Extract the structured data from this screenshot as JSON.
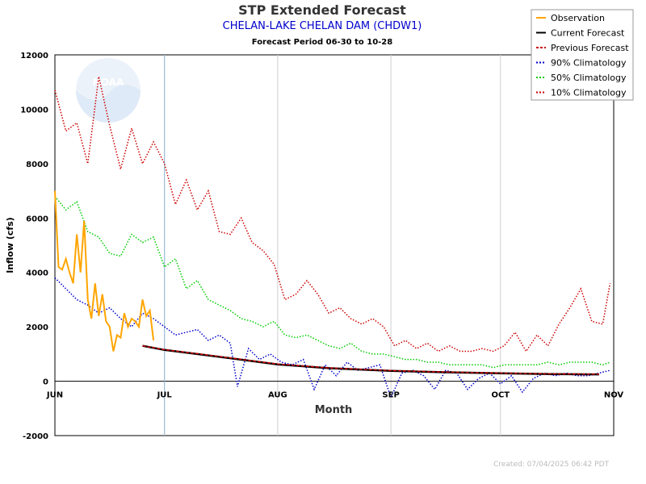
{
  "chart_data": {
    "type": "line",
    "title": "STP Extended Forecast",
    "subtitle": "CHELAN-LAKE CHELAN DAM (CHDW1)",
    "forecast_period": "Forecast Period  06-30 to  10-28",
    "xlabel": "Month",
    "ylabel": "Inflow (cfs)",
    "created": "Created:  07/04/2025 06:42 PDT",
    "logo_text": "NOAA",
    "xlim": [
      "2025-06-01",
      "2025-11-01"
    ],
    "ylim": [
      -2000,
      12000
    ],
    "yticks": [
      -2000,
      0,
      2000,
      4000,
      6000,
      8000,
      10000,
      12000
    ],
    "xticks": [
      {
        "date": "2025-06-01",
        "label": "JUN"
      },
      {
        "date": "2025-07-01",
        "label": "JUL"
      },
      {
        "date": "2025-08-01",
        "label": "AUG"
      },
      {
        "date": "2025-09-01",
        "label": "SEP"
      },
      {
        "date": "2025-10-01",
        "label": "OCT"
      },
      {
        "date": "2025-11-01",
        "label": "NOV"
      }
    ],
    "current_date_marker": "2025-07-01",
    "grid": true,
    "legend_position": "top-right",
    "series": [
      {
        "name": "Observation",
        "color": "#ffa500",
        "style": "solid",
        "x": [
          "2025-06-01",
          "2025-06-02",
          "2025-06-03",
          "2025-06-04",
          "2025-06-05",
          "2025-06-06",
          "2025-06-07",
          "2025-06-08",
          "2025-06-09",
          "2025-06-10",
          "2025-06-11",
          "2025-06-12",
          "2025-06-13",
          "2025-06-14",
          "2025-06-15",
          "2025-06-16",
          "2025-06-17",
          "2025-06-18",
          "2025-06-19",
          "2025-06-20",
          "2025-06-21",
          "2025-06-22",
          "2025-06-23",
          "2025-06-24",
          "2025-06-25",
          "2025-06-26",
          "2025-06-27",
          "2025-06-28"
        ],
        "y": [
          7000,
          4200,
          4100,
          4500,
          4000,
          3600,
          5400,
          4000,
          5900,
          3000,
          2300,
          3600,
          2400,
          3200,
          2200,
          2000,
          1100,
          1700,
          1600,
          2500,
          2000,
          2300,
          2200,
          2000,
          3000,
          2400,
          2600,
          1500
        ]
      },
      {
        "name": "Current Forecast",
        "color": "#000000",
        "style": "solid",
        "x": [
          "2025-06-25",
          "2025-07-01",
          "2025-07-10",
          "2025-07-20",
          "2025-08-01",
          "2025-08-15",
          "2025-09-01",
          "2025-09-15",
          "2025-10-01",
          "2025-10-15",
          "2025-10-28"
        ],
        "y": [
          1300,
          1150,
          1000,
          830,
          620,
          480,
          380,
          330,
          290,
          260,
          250
        ]
      },
      {
        "name": "Previous Forecast",
        "color": "#cc0000",
        "style": "dashed",
        "x": [
          "2025-06-25",
          "2025-07-01",
          "2025-07-10",
          "2025-07-20",
          "2025-08-01",
          "2025-08-15",
          "2025-09-01",
          "2025-09-15",
          "2025-10-01",
          "2025-10-15",
          "2025-10-28"
        ],
        "y": [
          1300,
          1160,
          1010,
          840,
          630,
          490,
          390,
          340,
          300,
          270,
          260
        ]
      },
      {
        "name": "90% Climatology",
        "color": "#0000cc",
        "style": "dotted",
        "x": [
          "2025-06-01",
          "2025-06-04",
          "2025-06-07",
          "2025-06-10",
          "2025-06-13",
          "2025-06-16",
          "2025-06-19",
          "2025-06-22",
          "2025-06-25",
          "2025-06-28",
          "2025-07-01",
          "2025-07-04",
          "2025-07-07",
          "2025-07-10",
          "2025-07-13",
          "2025-07-16",
          "2025-07-19",
          "2025-07-21",
          "2025-07-24",
          "2025-07-27",
          "2025-07-30",
          "2025-08-02",
          "2025-08-05",
          "2025-08-08",
          "2025-08-11",
          "2025-08-14",
          "2025-08-17",
          "2025-08-20",
          "2025-08-23",
          "2025-08-26",
          "2025-08-29",
          "2025-09-01",
          "2025-09-04",
          "2025-09-07",
          "2025-09-10",
          "2025-09-13",
          "2025-09-16",
          "2025-09-19",
          "2025-09-22",
          "2025-09-25",
          "2025-09-28",
          "2025-10-01",
          "2025-10-04",
          "2025-10-07",
          "2025-10-10",
          "2025-10-13",
          "2025-10-16",
          "2025-10-19",
          "2025-10-22",
          "2025-10-25",
          "2025-10-28",
          "2025-10-31"
        ],
        "y": [
          3800,
          3400,
          3000,
          2800,
          2500,
          2700,
          2300,
          2000,
          2500,
          2300,
          2000,
          1700,
          1800,
          1900,
          1500,
          1700,
          1400,
          -200,
          1200,
          800,
          1000,
          700,
          600,
          800,
          -300,
          600,
          200,
          700,
          400,
          500,
          600,
          -600,
          300,
          400,
          200,
          -300,
          400,
          300,
          -300,
          100,
          300,
          -100,
          200,
          -400,
          100,
          300,
          200,
          300,
          200,
          200,
          300,
          400
        ]
      },
      {
        "name": "50% Climatology",
        "color": "#00cc00",
        "style": "dotted",
        "x": [
          "2025-06-01",
          "2025-06-04",
          "2025-06-07",
          "2025-06-10",
          "2025-06-13",
          "2025-06-16",
          "2025-06-19",
          "2025-06-22",
          "2025-06-25",
          "2025-06-28",
          "2025-07-01",
          "2025-07-04",
          "2025-07-07",
          "2025-07-10",
          "2025-07-13",
          "2025-07-16",
          "2025-07-19",
          "2025-07-22",
          "2025-07-25",
          "2025-07-28",
          "2025-07-31",
          "2025-08-03",
          "2025-08-06",
          "2025-08-09",
          "2025-08-12",
          "2025-08-15",
          "2025-08-18",
          "2025-08-21",
          "2025-08-24",
          "2025-08-27",
          "2025-08-30",
          "2025-09-02",
          "2025-09-05",
          "2025-09-08",
          "2025-09-11",
          "2025-09-14",
          "2025-09-17",
          "2025-09-20",
          "2025-09-23",
          "2025-09-26",
          "2025-09-29",
          "2025-10-02",
          "2025-10-05",
          "2025-10-08",
          "2025-10-11",
          "2025-10-14",
          "2025-10-17",
          "2025-10-20",
          "2025-10-23",
          "2025-10-26",
          "2025-10-29",
          "2025-10-31"
        ],
        "y": [
          6800,
          6300,
          6600,
          5500,
          5300,
          4700,
          4600,
          5400,
          5100,
          5300,
          4200,
          4500,
          3400,
          3700,
          3000,
          2800,
          2600,
          2300,
          2200,
          2000,
          2200,
          1700,
          1600,
          1700,
          1500,
          1300,
          1200,
          1400,
          1100,
          1000,
          1000,
          900,
          800,
          800,
          700,
          700,
          600,
          600,
          600,
          600,
          500,
          600,
          600,
          600,
          600,
          700,
          600,
          700,
          700,
          700,
          600,
          700
        ]
      },
      {
        "name": "10% Climatology",
        "color": "#cc0000",
        "style": "dotted",
        "x": [
          "2025-06-01",
          "2025-06-04",
          "2025-06-07",
          "2025-06-10",
          "2025-06-13",
          "2025-06-16",
          "2025-06-19",
          "2025-06-22",
          "2025-06-25",
          "2025-06-28",
          "2025-07-01",
          "2025-07-04",
          "2025-07-07",
          "2025-07-10",
          "2025-07-13",
          "2025-07-16",
          "2025-07-19",
          "2025-07-22",
          "2025-07-25",
          "2025-07-28",
          "2025-07-31",
          "2025-08-03",
          "2025-08-06",
          "2025-08-09",
          "2025-08-12",
          "2025-08-15",
          "2025-08-18",
          "2025-08-21",
          "2025-08-24",
          "2025-08-27",
          "2025-08-30",
          "2025-09-02",
          "2025-09-05",
          "2025-09-08",
          "2025-09-11",
          "2025-09-14",
          "2025-09-17",
          "2025-09-20",
          "2025-09-23",
          "2025-09-26",
          "2025-09-29",
          "2025-10-02",
          "2025-10-05",
          "2025-10-08",
          "2025-10-11",
          "2025-10-14",
          "2025-10-17",
          "2025-10-20",
          "2025-10-23",
          "2025-10-26",
          "2025-10-29",
          "2025-10-31"
        ],
        "y": [
          10700,
          9200,
          9500,
          8000,
          11200,
          9400,
          7800,
          9300,
          8000,
          8800,
          8000,
          6500,
          7400,
          6300,
          7000,
          5500,
          5400,
          6000,
          5100,
          4800,
          4300,
          3000,
          3200,
          3700,
          3200,
          2500,
          2700,
          2300,
          2100,
          2300,
          2000,
          1300,
          1500,
          1200,
          1400,
          1100,
          1300,
          1100,
          1100,
          1200,
          1100,
          1300,
          1800,
          1100,
          1700,
          1300,
          2100,
          2700,
          3400,
          2200,
          2100,
          3600
        ]
      }
    ]
  }
}
